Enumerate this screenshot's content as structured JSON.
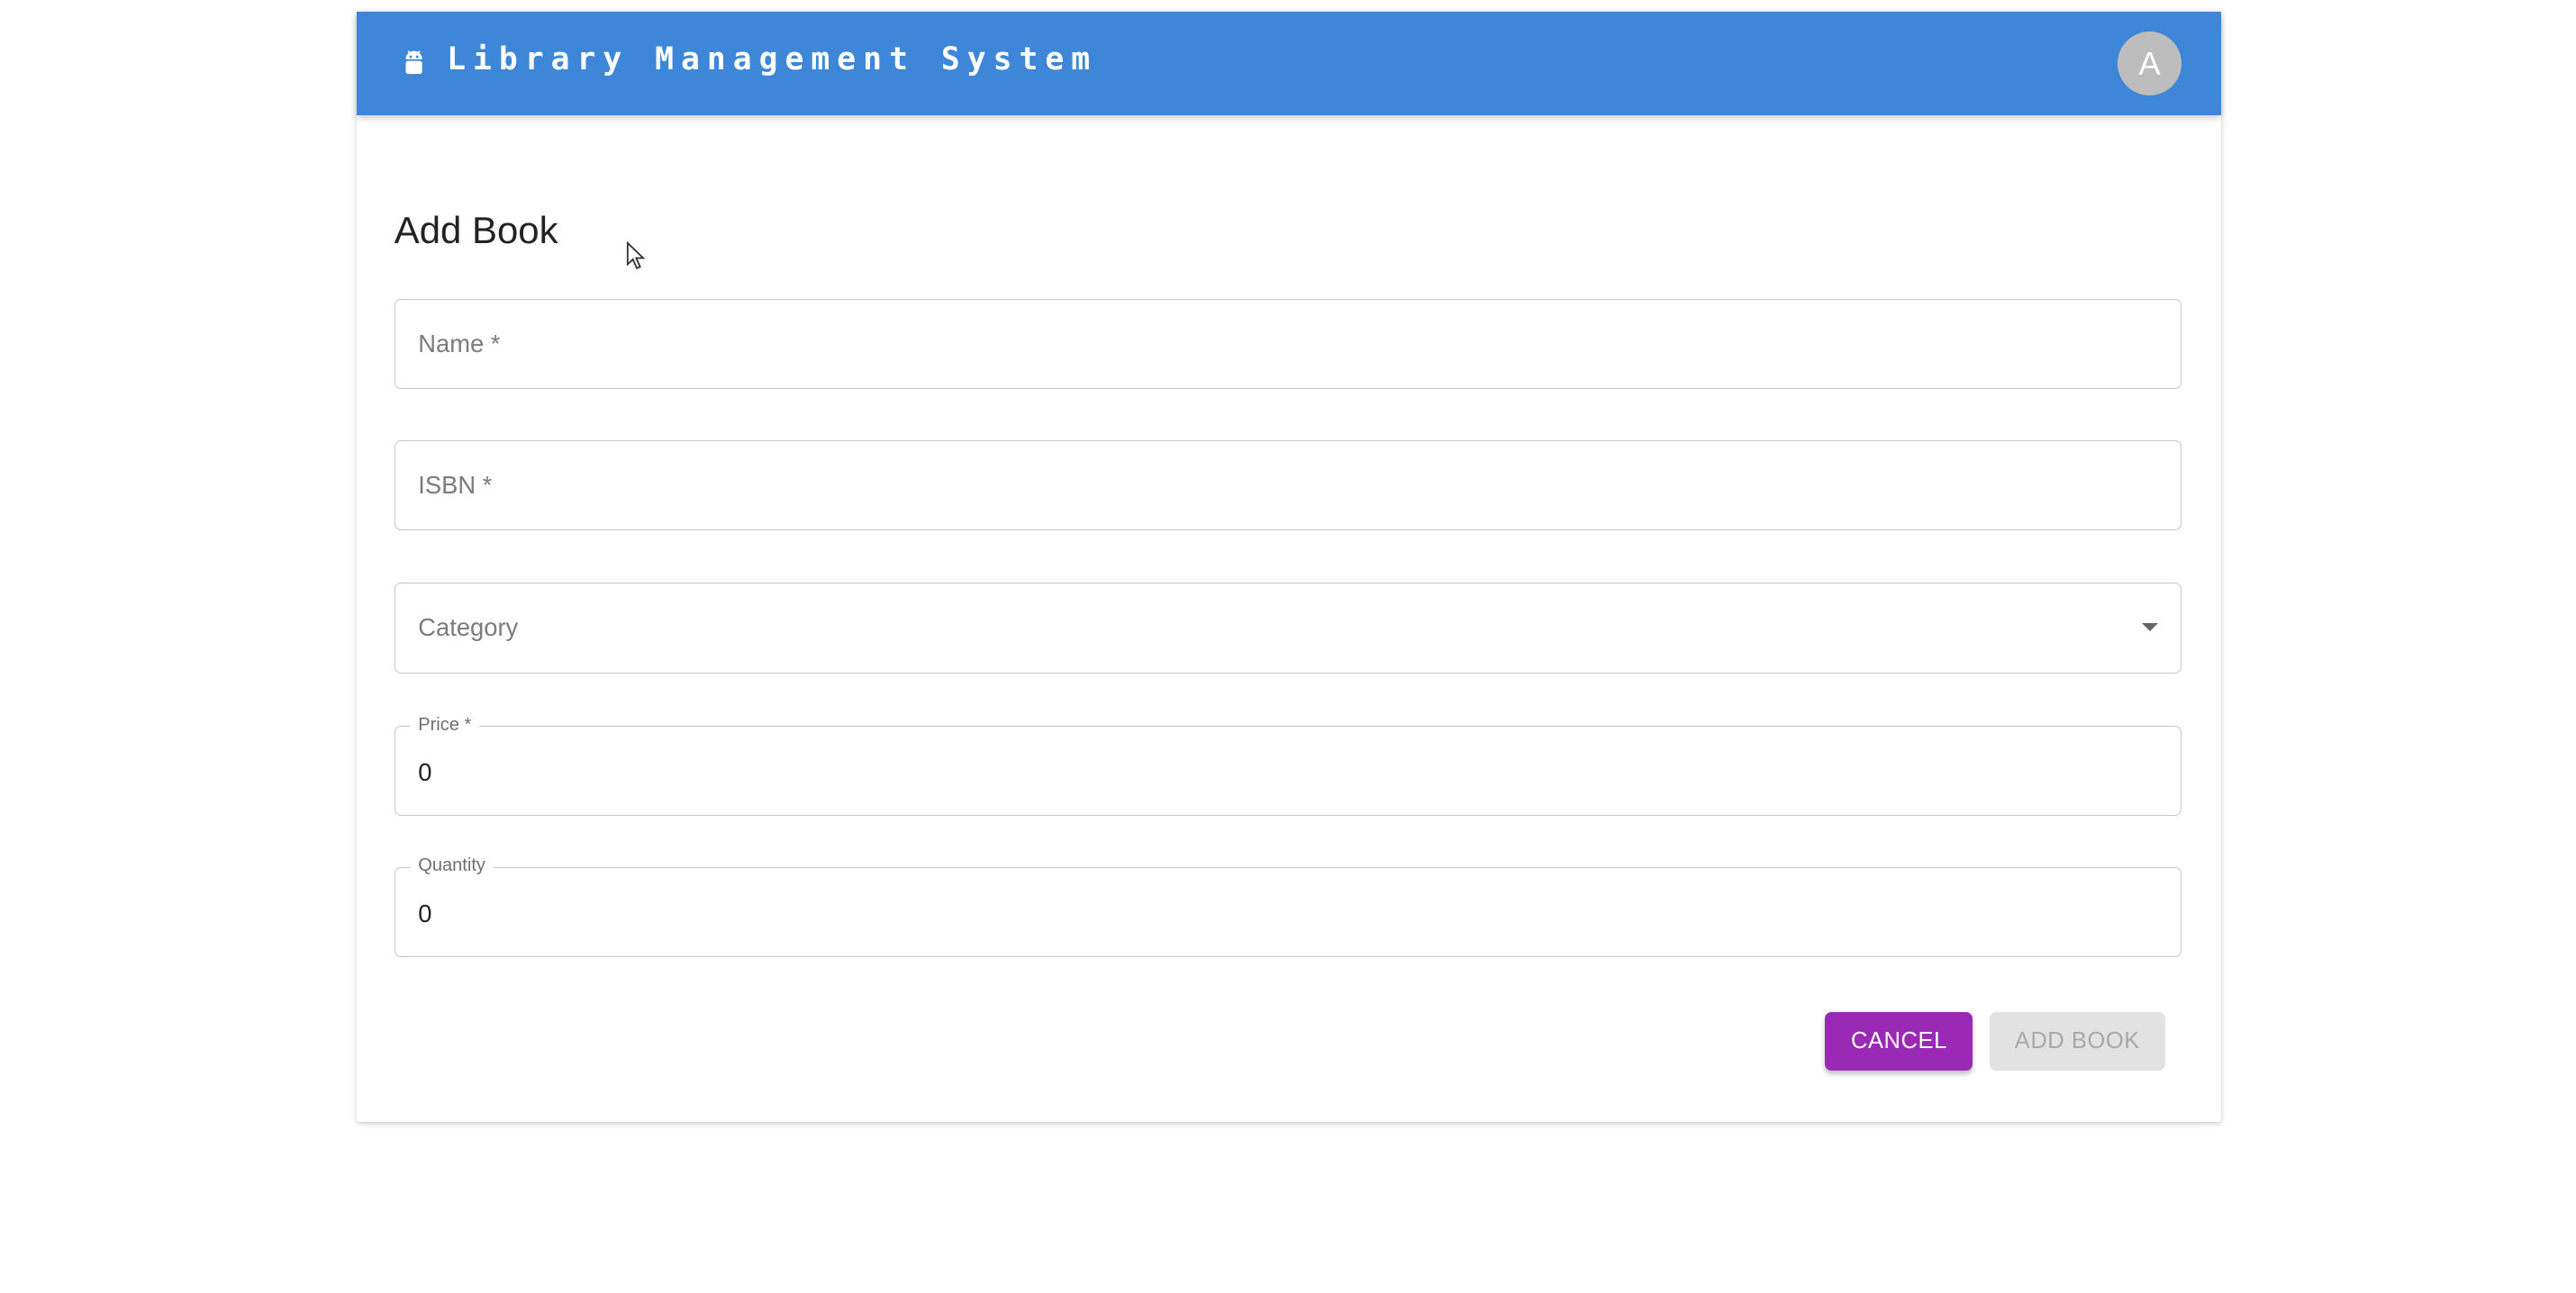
{
  "app": {
    "title": "Library Management System",
    "icon": "android-icon",
    "avatar_initial": "A",
    "brand_color": "#3d86d8"
  },
  "page": {
    "title": "Add Book"
  },
  "form": {
    "name": {
      "placeholder": "Name *",
      "value": ""
    },
    "isbn": {
      "placeholder": "ISBN *",
      "value": ""
    },
    "category": {
      "placeholder": "Category",
      "value": "",
      "icon": "caret-down-icon"
    },
    "price": {
      "label": "Price *",
      "value": "0"
    },
    "quantity": {
      "label": "Quantity",
      "value": "0"
    }
  },
  "actions": {
    "cancel_label": "Cancel",
    "cancel_color": "#9a2ab5",
    "add_label": "Add Book",
    "add_disabled": true
  }
}
